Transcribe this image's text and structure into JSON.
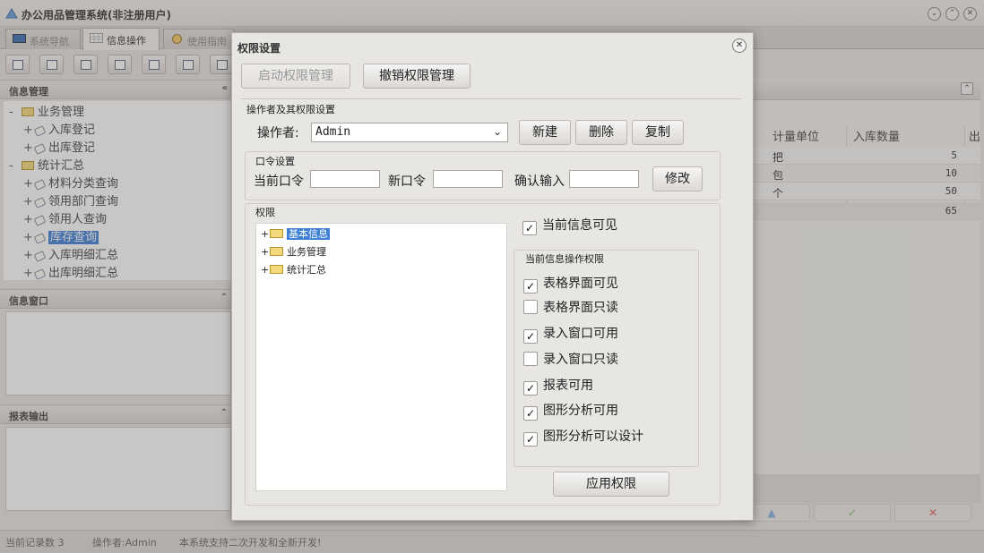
{
  "window": {
    "title": "办公用品管理系统(非注册用户)"
  },
  "tabs": [
    {
      "label": "系统导航"
    },
    {
      "label": "信息操作"
    },
    {
      "label": "使用指南"
    }
  ],
  "left": {
    "panel_title": "信息管理",
    "tree": [
      {
        "label": "业务管理"
      },
      {
        "label": "入库登记"
      },
      {
        "label": "出库登记"
      },
      {
        "label": "统计汇总"
      },
      {
        "label": "材料分类查询"
      },
      {
        "label": "领用部门查询"
      },
      {
        "label": "领用人查询"
      },
      {
        "label": "库存查询"
      },
      {
        "label": "入库明细汇总"
      },
      {
        "label": "出库明细汇总"
      }
    ],
    "info_window_title": "信息窗口",
    "report_output_title": "报表输出"
  },
  "grid": {
    "columns": [
      "计量单位",
      "入库数量",
      "出"
    ],
    "rows": [
      {
        "unit": "把",
        "qty": "5"
      },
      {
        "unit": "包",
        "qty": "10"
      },
      {
        "unit": "个",
        "qty": "50"
      },
      {
        "unit": "",
        "qty": "65"
      }
    ]
  },
  "statusbar": {
    "record_count": "当前记录数 3",
    "operator": "操作者:Admin",
    "message": "本系统支持二次开发和全新开发!"
  },
  "dialog": {
    "title": "权限设置",
    "enable_btn": "启动权限管理",
    "revoke_btn": "撤销权限管理",
    "operator_group": "操作者及其权限设置",
    "operator_label": "操作者:",
    "operator_value": "Admin",
    "new_btn": "新建",
    "delete_btn": "删除",
    "copy_btn": "复制",
    "password_group": "口令设置",
    "current_pw_label": "当前口令",
    "new_pw_label": "新口令",
    "confirm_label": "确认输入",
    "modify_btn": "修改",
    "permission_group": "权限",
    "perm_tree": [
      {
        "label": "基本信息"
      },
      {
        "label": "业务管理"
      },
      {
        "label": "统计汇总"
      }
    ],
    "current_info_visible": "当前信息可见",
    "ops_group": "当前信息操作权限",
    "checks": [
      {
        "label": "表格界面可见",
        "checked": true
      },
      {
        "label": "表格界面只读",
        "checked": false
      },
      {
        "label": "录入窗口可用",
        "checked": true
      },
      {
        "label": "录入窗口只读",
        "checked": false
      },
      {
        "label": "报表可用",
        "checked": true
      },
      {
        "label": "图形分析可用",
        "checked": true
      },
      {
        "label": "图形分析可以设计",
        "checked": true
      }
    ],
    "apply_btn": "应用权限"
  }
}
